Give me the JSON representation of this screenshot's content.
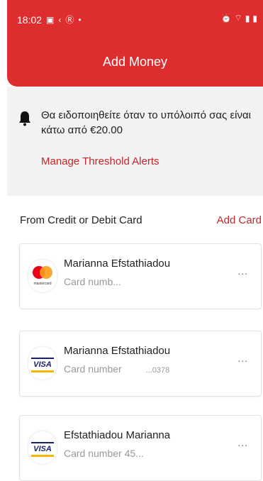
{
  "status_bar": {
    "time": "18:02",
    "icons_left": [
      "image-icon",
      "back-icon",
      "r-icon",
      "dot-icon"
    ],
    "icons_right": [
      "alarm-icon",
      "wifi-icon",
      "signal-icon",
      "battery-icon"
    ]
  },
  "header": {
    "title": "Add Money",
    "color": "#dd2d2f"
  },
  "alert": {
    "text": "Θα ειδοποιηθείτε όταν το υπόλοιπό σας είναι κάτω από €20.00",
    "link": "Manage Threshold Alerts"
  },
  "section": {
    "label": "From Credit or Debit Card",
    "add_card": "Add Card"
  },
  "cards": [
    {
      "brand": "mastercard",
      "brand_label": "mastercard",
      "name": "Marianna Efstathiadou",
      "number": "Card numb..."
    },
    {
      "brand": "visa",
      "brand_label": "VISA",
      "name": "Marianna Efstathiadou",
      "number": "Card number",
      "number_tail": "...0378"
    },
    {
      "brand": "visa",
      "brand_label": "VISA",
      "name": "Efstathiadou Marianna",
      "number": "Card number 45..."
    }
  ],
  "menu_label": "..."
}
